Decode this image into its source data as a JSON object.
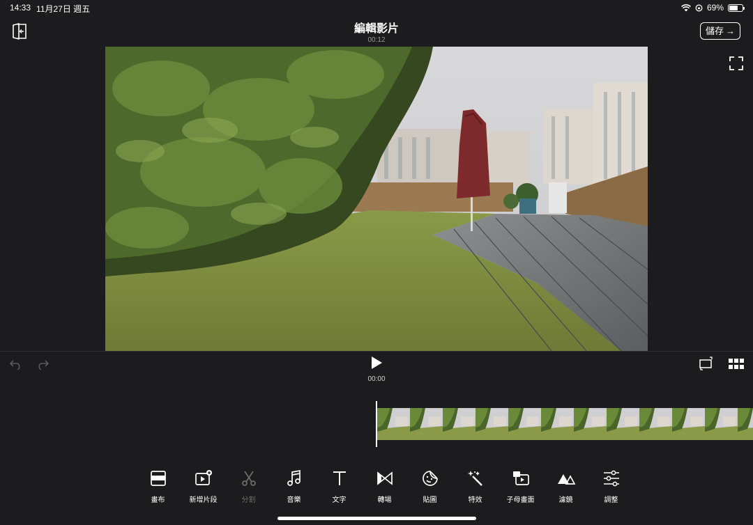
{
  "status_bar": {
    "time": "14:33",
    "date": "11月27日 週五",
    "battery_text": "69%",
    "battery_level": 0.69
  },
  "header": {
    "title": "編輯影片",
    "duration": "00:12",
    "save_label": "儲存",
    "save_arrow": "→",
    "exit_icon": "exit-door-icon"
  },
  "preview": {
    "fullscreen_icon": "fullscreen-icon"
  },
  "playback": {
    "current_time": "00:00",
    "undo_icon": "undo-icon",
    "redo_icon": "redo-icon",
    "play_icon": "play-icon",
    "aspect_icon": "aspect-ratio-icon",
    "grid_icon": "grid-view-icon"
  },
  "timeline": {
    "thumbnail_count": 12
  },
  "toolbar": {
    "tools": [
      {
        "label": "畫布",
        "icon": "canvas-icon",
        "enabled": true
      },
      {
        "label": "新增片段",
        "icon": "add-clip-icon",
        "enabled": true
      },
      {
        "label": "分割",
        "icon": "scissors-icon",
        "enabled": false
      },
      {
        "label": "音樂",
        "icon": "music-icon",
        "enabled": true
      },
      {
        "label": "文字",
        "icon": "text-icon",
        "enabled": true
      },
      {
        "label": "轉場",
        "icon": "transition-icon",
        "enabled": true
      },
      {
        "label": "貼圖",
        "icon": "sticker-icon",
        "enabled": true
      },
      {
        "label": "特效",
        "icon": "effects-wand-icon",
        "enabled": true
      },
      {
        "label": "子母畫面",
        "icon": "picture-in-picture-icon",
        "enabled": true
      },
      {
        "label": "濾鏡",
        "icon": "filter-icon",
        "enabled": true
      },
      {
        "label": "調整",
        "icon": "adjust-sliders-icon",
        "enabled": true
      }
    ]
  },
  "colors": {
    "background": "#1c1c1e",
    "accent": "#ffffff",
    "disabled": "#6e6e6e"
  }
}
